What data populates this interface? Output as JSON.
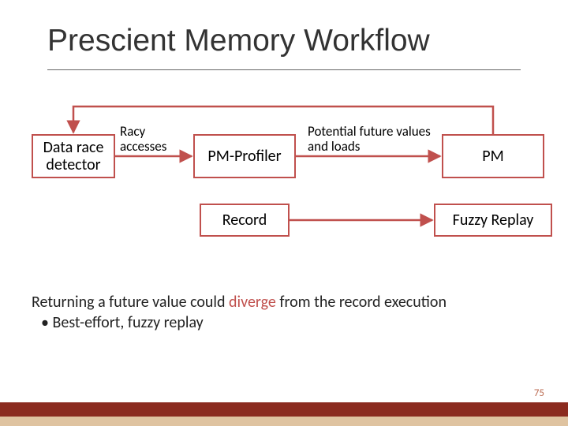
{
  "title": "Prescient Memory Workflow",
  "boxes": {
    "data_race_detector": "Data race detector",
    "pm_profiler": "PM-Profiler",
    "pm": "PM",
    "record": "Record",
    "fuzzy_replay": "Fuzzy Replay"
  },
  "edge_labels": {
    "racy_accesses": "Racy accesses",
    "potential_future": "Potential future values and loads"
  },
  "body": {
    "line1_pre": "Returning a future value could ",
    "line1_accent": "diverge",
    "line1_post": " from the record execution",
    "bullet1": "•  Best-effort, fuzzy replay"
  },
  "page_number": "75",
  "colors": {
    "accent": "#c0504d",
    "footer_dark": "#8b2b1f",
    "footer_light": "#dfc3a0"
  }
}
